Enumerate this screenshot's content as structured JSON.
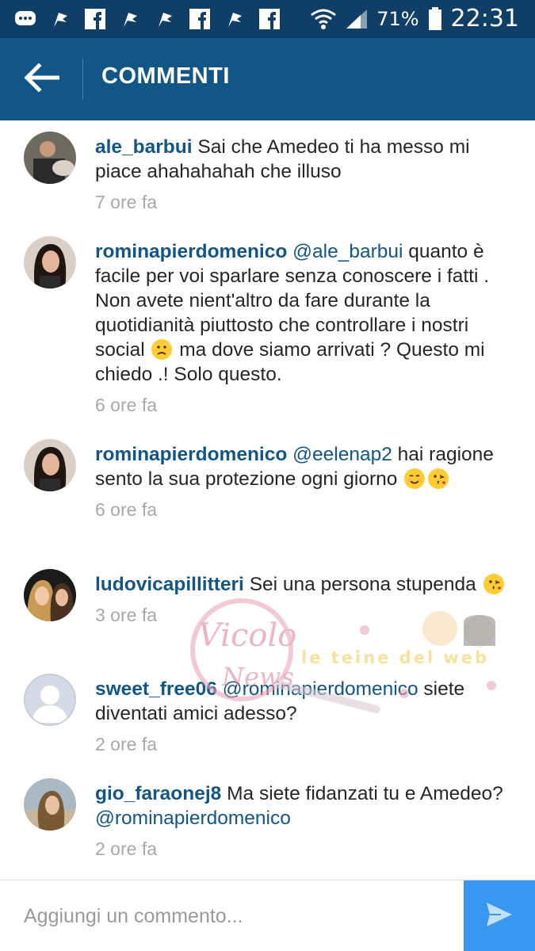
{
  "status_bar": {
    "battery": "71%",
    "time": "22:31",
    "icons": [
      "chat-bubble-icon",
      "flag-icon",
      "facebook-icon",
      "flag-icon",
      "flag-icon",
      "facebook-icon",
      "flag-icon",
      "facebook-icon",
      "wifi-icon",
      "signal-icon",
      "battery-icon"
    ]
  },
  "header": {
    "title": "COMMENTI",
    "back_icon": "arrow-left-icon"
  },
  "comments": [
    {
      "username": "ale_barbui",
      "text": "Sai che Amedeo ti ha messo mi piace ahahahahah che illuso",
      "time": "7 ore fa"
    },
    {
      "username": "rominapierdomenico",
      "mention": "@ale_barbui",
      "text_part1": "quanto è facile per voi sparlare senza conoscere i fatti . Non avete nient'altro da fare durante la quotidianità piuttosto che controllare i nostri social",
      "text_part2": "ma dove siamo arrivati ? Questo mi chiedo .! Solo questo.",
      "time": "6 ore fa"
    },
    {
      "username": "rominapierdomenico",
      "mention": "@eelenap2",
      "text": "hai ragione sento la sua protezione ogni giorno",
      "time": "6 ore fa"
    },
    {
      "username": "ludovicapillitteri",
      "text": "Sei una persona stupenda",
      "time": "3 ore fa"
    },
    {
      "username": "sweet_free06",
      "mention": "@rominapierdomenico",
      "text": "siete diventati amici adesso?",
      "time": "2 ore fa"
    },
    {
      "username": "gio_faraonej8",
      "text": "Ma siete fidanzati tu e Amedeo?",
      "mention": "@rominapierdomenico",
      "time": "2 ore fa"
    }
  ],
  "watermark": {
    "text": "Vicolo delle News",
    "tagline": "le teine del web"
  },
  "composer": {
    "placeholder": "Aggiungi un commento..."
  },
  "colors": {
    "header": "#125688",
    "status_bar": "#0f3f66",
    "username": "#125688",
    "send_button": "#3897f0"
  }
}
